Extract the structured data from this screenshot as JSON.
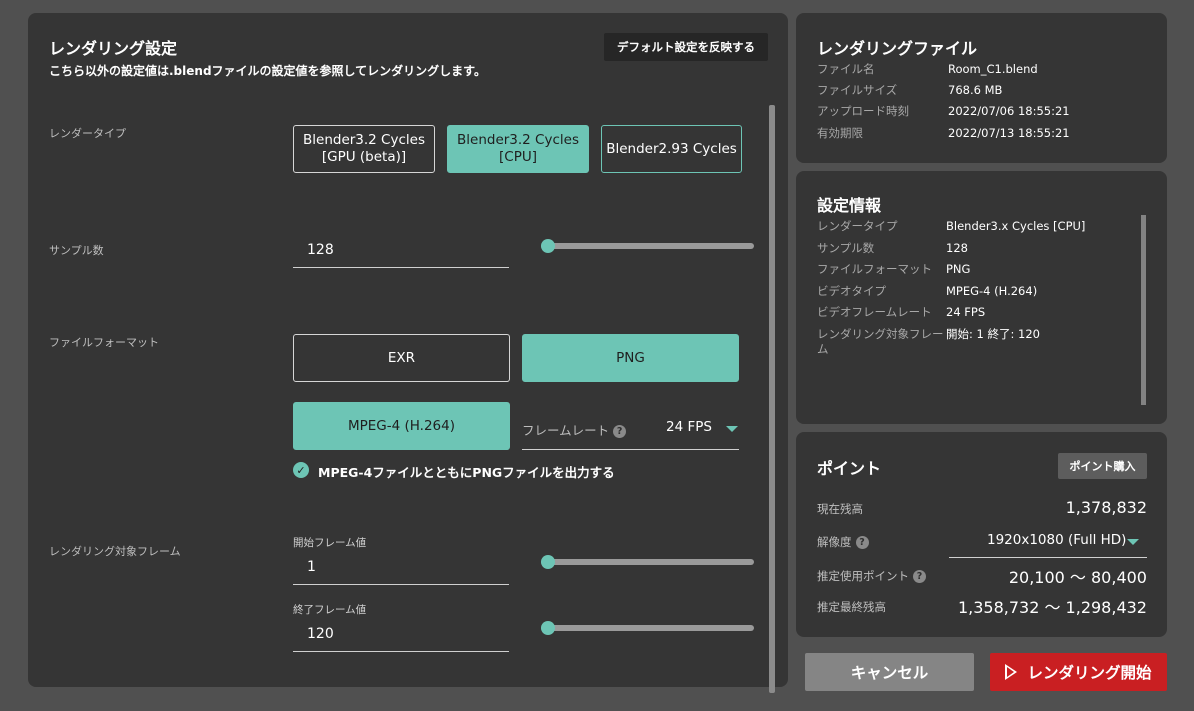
{
  "settings": {
    "title": "レンダリング設定",
    "description": "こちら以外の設定値は.blendファイルの設定値を参照してレンダリングします。",
    "default_button": "デフォルト設定を反映する",
    "render_type": {
      "label": "レンダータイプ",
      "options": [
        {
          "line1": "Blender3.2 Cycles",
          "line2": "[GPU (beta)]",
          "selected": false
        },
        {
          "line1": "Blender3.2 Cycles",
          "line2": "[CPU]",
          "selected": true
        },
        {
          "line1": "Blender2.93 Cycles",
          "line2": "",
          "selected": false
        }
      ]
    },
    "samples": {
      "label": "サンプル数",
      "value": "128",
      "slider_fraction": 0.0
    },
    "file_format": {
      "label": "ファイルフォーマット",
      "options": [
        {
          "label": "EXR",
          "selected": false
        },
        {
          "label": "PNG",
          "selected": true
        },
        {
          "label": "MPEG-4 (H.264)",
          "selected": true
        }
      ],
      "framerate_label": "フレームレート",
      "framerate_value": "24 FPS",
      "png_checkbox_label": "MPEG-4ファイルとともにPNGファイルを出力する",
      "png_checkbox_checked": true
    },
    "frames": {
      "label": "レンダリング対象フレーム",
      "start_label": "開始フレーム値",
      "start_value": "1",
      "end_label": "終了フレーム値",
      "end_value": "120",
      "start_slider_fraction": 0.0,
      "end_slider_fraction": 0.0
    }
  },
  "file": {
    "title": "レンダリングファイル",
    "rows": [
      {
        "label": "ファイル名",
        "value": "Room_C1.blend"
      },
      {
        "label": "ファイルサイズ",
        "value": "768.6 MB"
      },
      {
        "label": "アップロード時刻",
        "value": "2022/07/06 18:55:21"
      },
      {
        "label": "有効期限",
        "value": "2022/07/13 18:55:21"
      }
    ]
  },
  "info": {
    "title": "設定情報",
    "rows": [
      {
        "label": "レンダータイプ",
        "value": "Blender3.x Cycles [CPU]"
      },
      {
        "label": "サンプル数",
        "value": "128"
      },
      {
        "label": "ファイルフォーマット",
        "value": "PNG"
      },
      {
        "label": "ビデオタイプ",
        "value": "MPEG-4 (H.264)"
      },
      {
        "label": "ビデオフレームレート",
        "value": "24 FPS"
      },
      {
        "label": "レンダリング対象フレーム",
        "value": "開始: 1 終了: 120"
      }
    ]
  },
  "points": {
    "title": "ポイント",
    "buy_button": "ポイント購入",
    "balance_label": "現在残高",
    "balance_value": "1,378,832",
    "resolution_label": "解像度",
    "resolution_value": "1920x1080 (Full HD)",
    "estimate_label": "推定使用ポイント",
    "estimate_value": "20,100 〜 80,400",
    "final_label": "推定最終残高",
    "final_value": "1,358,732 〜 1,298,432"
  },
  "actions": {
    "cancel": "キャンセル",
    "start": "レンダリング開始"
  },
  "colors": {
    "accent": "#6dc5b5",
    "panel": "#353535",
    "background": "#505050",
    "danger": "#c91f22"
  }
}
